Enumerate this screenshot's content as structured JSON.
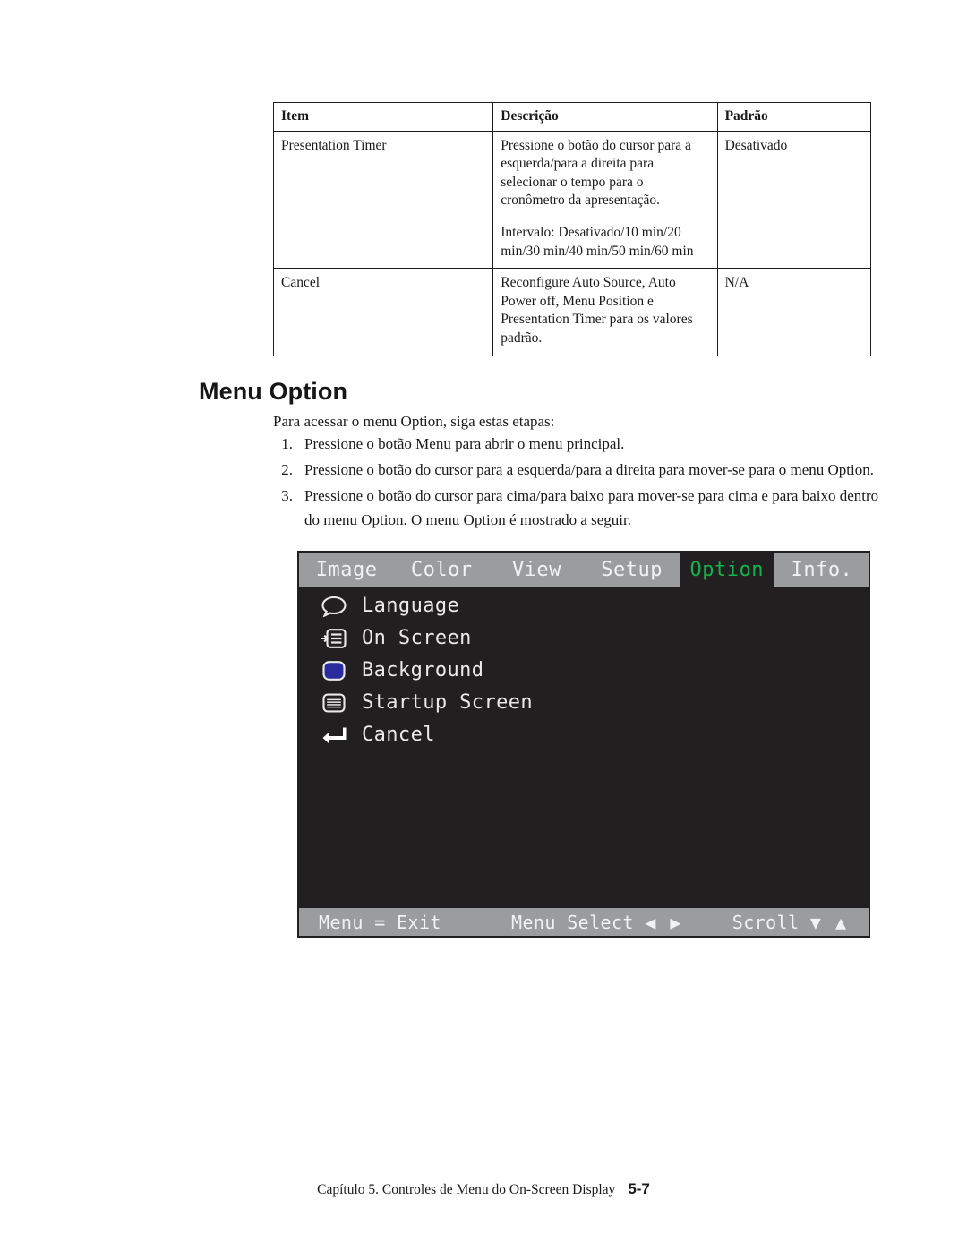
{
  "table": {
    "headers": [
      "Item",
      "Descrição",
      "Padrão"
    ],
    "rows": [
      {
        "item": "Presentation Timer",
        "desc_1": "Pressione o botão do cursor para a esquerda/para a direita para selecionar o tempo para o cronômetro da apresentação.",
        "desc_2": "Intervalo: Desativado/10 min/20 min/30 min/40 min/50 min/60 min",
        "default": "Desativado"
      },
      {
        "item": "Cancel",
        "desc_1": "Reconfigure Auto Source, Auto Power off, Menu Position e Presentation Timer para os valores padrão.",
        "desc_2": "",
        "default": "N/A"
      }
    ]
  },
  "section": {
    "heading": "Menu Option",
    "intro": "Para acessar o menu Option, siga estas etapas:",
    "steps": [
      {
        "num": "1.",
        "text": "Pressione o botão Menu para abrir o menu principal."
      },
      {
        "num": "2.",
        "text": "Pressione o botão do cursor para a esquerda/para a direita para mover-se para o menu Option."
      },
      {
        "num": "3.",
        "text": "Pressione o botão do cursor para cima/para baixo para mover-se para cima e para baixo dentro do menu Option. O menu Option é mostrado a seguir."
      }
    ]
  },
  "osd": {
    "tabs": [
      {
        "label": "Image",
        "selected": false
      },
      {
        "label": "Color",
        "selected": false
      },
      {
        "label": "View",
        "selected": false
      },
      {
        "label": "Setup",
        "selected": false
      },
      {
        "label": "Option",
        "selected": true
      },
      {
        "label": "Info.",
        "selected": false
      }
    ],
    "selected_tab": "Option",
    "items": [
      {
        "label": "Language",
        "icon": "speech-bubble-icon"
      },
      {
        "label": "On Screen",
        "icon": "on-screen-display-icon"
      },
      {
        "label": "Background",
        "icon": "background-color-swatch-icon"
      },
      {
        "label": "Startup Screen",
        "icon": "ibm-logo-icon"
      },
      {
        "label": "Cancel",
        "icon": "enter-return-arrow-icon"
      }
    ],
    "footer": {
      "exit": "Menu = Exit",
      "select": "Menu Select",
      "select_arrows": "◀ ▶",
      "scroll": "Scroll",
      "scroll_arrows": "▼ ▲"
    },
    "colors": {
      "tab_bar": "#9a9c9d",
      "panel": "#211f20",
      "selected_tab_text": "#16b14b",
      "text": "#e9e9e9",
      "background_swatch": "#2b2b9e"
    }
  },
  "footer": {
    "text": "Capítulo 5. Controles de Menu do On-Screen Display",
    "folio": "5-7"
  }
}
